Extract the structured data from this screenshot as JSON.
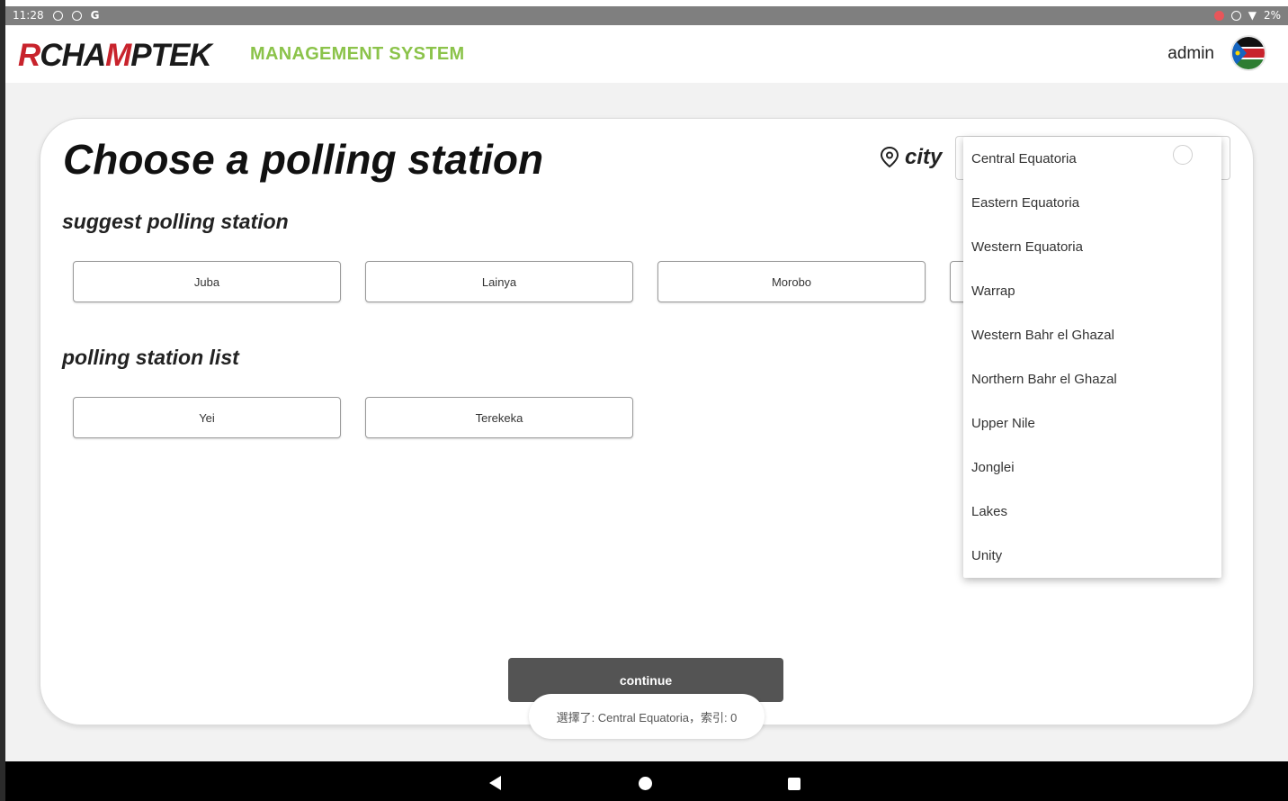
{
  "status_bar": {
    "time": "11:28",
    "left_icons": [
      "signal-icon",
      "g-icon"
    ],
    "g_label": "G",
    "battery": "2%"
  },
  "header": {
    "logo_text": {
      "r": "R",
      "cha": "CHA",
      "m": "M",
      "ptek": "PTEK"
    },
    "app_subtitle": "MANAGEMENT SYSTEM",
    "user_name": "admin",
    "avatar_icon": "south-sudan-flag-avatar"
  },
  "page": {
    "title": "Choose a polling station",
    "suggest_heading": "suggest polling station",
    "suggested_stations": [
      "Juba",
      "Lainya",
      "Morobo"
    ],
    "list_heading": "polling station list",
    "stations": [
      "Yei",
      "Terekeka"
    ],
    "city_label": "city",
    "continue_label": "continue"
  },
  "city_select": {
    "selected": "Central Equatoria",
    "options": [
      "Central Equatoria",
      "Eastern Equatoria",
      "Western Equatoria",
      "Warrap",
      "Western Bahr el Ghazal",
      "Northern Bahr el Ghazal",
      "Upper Nile",
      "Jonglei",
      "Lakes",
      "Unity"
    ]
  },
  "toast": {
    "message": "選擇了: Central Equatoria，索引: 0"
  },
  "colors": {
    "brand_red": "#c8232c",
    "subtitle_green": "#8bc34a",
    "continue_bg": "#545454"
  }
}
